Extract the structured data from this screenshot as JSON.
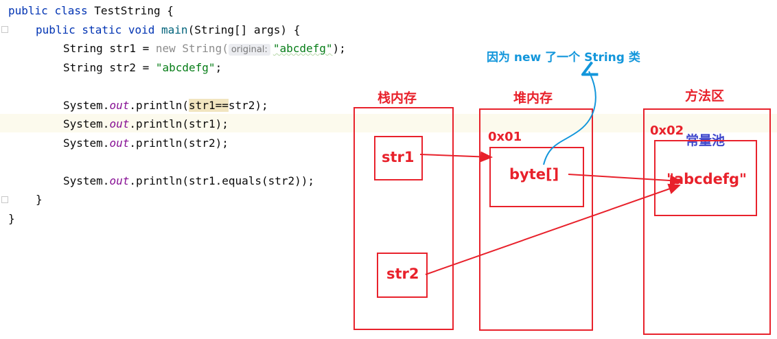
{
  "code": {
    "line1": {
      "kw_public": "public",
      "kw_class": "class",
      "name": "TestString {"
    },
    "line2": {
      "mods": "public static void",
      "fn": "main",
      "rest": "(String[] args) {"
    },
    "line3": {
      "pre": "String str1 = ",
      "kw_new": "new",
      "mid": " String(",
      "hint": "original:",
      "arg": "\"abcdefg\"",
      "end": ");"
    },
    "line4": {
      "pre": "String str2 = ",
      "arg": "\"abcdefg\"",
      "end": ";"
    },
    "line5": {
      "pre": "System.",
      "fld": "out",
      "mid": ".println(",
      "match": "str1==",
      "rest": "str2);"
    },
    "line6": {
      "pre": "System.",
      "fld": "out",
      "rest": ".println(str1);"
    },
    "line7": {
      "pre": "System.",
      "fld": "out",
      "rest": ".println(str2);"
    },
    "line8": {
      "pre": "System.",
      "fld": "out",
      "rest": ".println(str1.equals(str2));"
    },
    "line9": "}",
    "line10": "}"
  },
  "diagram": {
    "note": "因为 new 了一个 String 类",
    "stack_title": "栈内存",
    "heap_title": "堆内存",
    "method_title": "方法区",
    "heap_addr": "0x01",
    "method_addr": "0x02",
    "pool_title": "常量池",
    "str1": "str1",
    "str2": "str2",
    "bytes": "byte[]",
    "pool_value": "\"abcdefg\""
  },
  "colors": {
    "red": "#e8212b",
    "blue_note": "#1296db",
    "pool_title": "#3f48cc",
    "keyword": "#0033b3",
    "string": "#067d17",
    "field": "#871094",
    "highlight_line": "#fcfaed"
  }
}
